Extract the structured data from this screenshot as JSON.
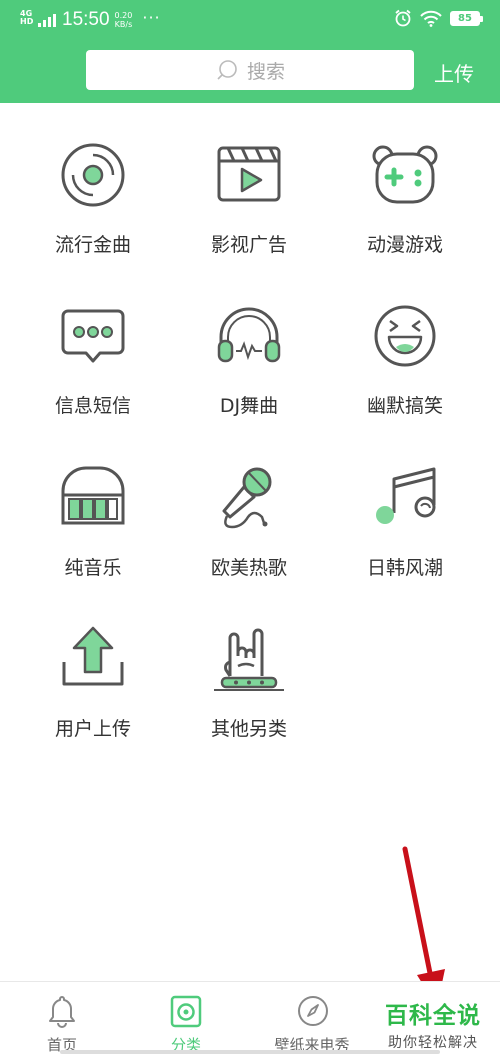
{
  "status_bar": {
    "network": "4G HD",
    "time": "15:50",
    "speed_value": "0.20",
    "speed_unit": "KB/s",
    "more": "···",
    "battery": "85"
  },
  "header": {
    "search_placeholder": "搜索",
    "upload_label": "上传",
    "bg_color": "#4fcb7c"
  },
  "categories": [
    {
      "label": "流行金曲",
      "icon": "vinyl-disc-icon"
    },
    {
      "label": "影视广告",
      "icon": "video-clapper-icon"
    },
    {
      "label": "动漫游戏",
      "icon": "gamepad-bear-icon"
    },
    {
      "label": "信息短信",
      "icon": "message-bubble-icon"
    },
    {
      "label": "DJ舞曲",
      "icon": "headphones-icon"
    },
    {
      "label": "幽默搞笑",
      "icon": "laughing-face-icon"
    },
    {
      "label": "纯音乐",
      "icon": "piano-icon"
    },
    {
      "label": "欧美热歌",
      "icon": "microphone-icon"
    },
    {
      "label": "日韩风潮",
      "icon": "music-note-icon"
    },
    {
      "label": "用户上传",
      "icon": "upload-tray-icon"
    },
    {
      "label": "其他另类",
      "icon": "rock-hand-icon"
    }
  ],
  "tabbar": {
    "tabs": [
      {
        "label": "首页",
        "icon": "bell-icon"
      },
      {
        "label": "分类",
        "icon": "category-disc-icon",
        "active": true
      },
      {
        "label": "壁纸来电秀",
        "icon": "compass-icon"
      }
    ]
  },
  "watermark": {
    "title": "百科全说",
    "subtitle": "助你轻松解决"
  }
}
